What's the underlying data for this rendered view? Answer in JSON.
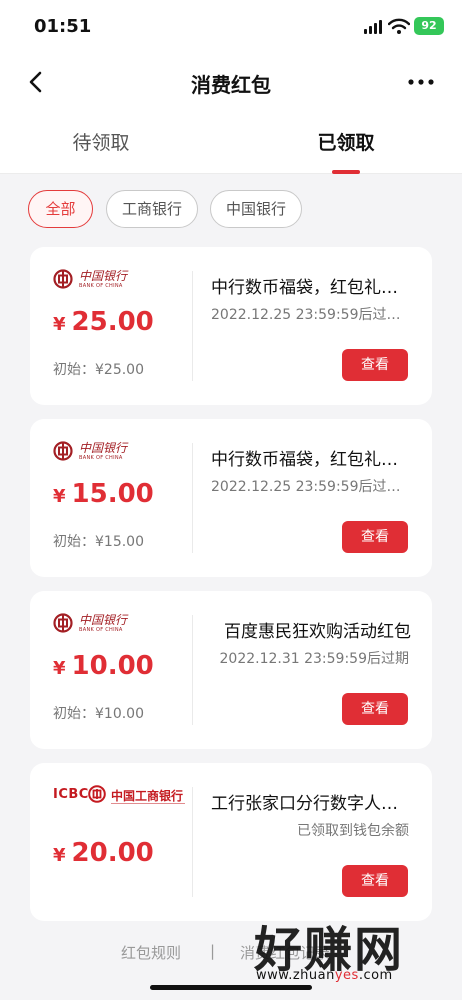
{
  "status_bar": {
    "time": "01:51",
    "battery": "92"
  },
  "nav": {
    "title": "消费红包"
  },
  "tabs": [
    {
      "label": "待领取",
      "active": false
    },
    {
      "label": "已领取",
      "active": true
    }
  ],
  "filters": [
    {
      "label": "全部",
      "active": true
    },
    {
      "label": "工商银行",
      "active": false
    },
    {
      "label": "中国银行",
      "active": false
    }
  ],
  "cards": [
    {
      "bank": "BOC",
      "logo_cn": "中国银行",
      "logo_en": "BANK OF CHINA",
      "currency": "¥",
      "amount": "25.00",
      "initial": "初始：¥25.00",
      "name": "中行数币福袋，红包礼…",
      "subtitle": "2022.12.25 23:59:59后过…",
      "button": "查看"
    },
    {
      "bank": "BOC",
      "logo_cn": "中国银行",
      "logo_en": "BANK OF CHINA",
      "currency": "¥",
      "amount": "15.00",
      "initial": "初始：¥15.00",
      "name": "中行数币福袋，红包礼…",
      "subtitle": "2022.12.25 23:59:59后过…",
      "button": "查看"
    },
    {
      "bank": "BOC",
      "logo_cn": "中国银行",
      "logo_en": "BANK OF CHINA",
      "currency": "¥",
      "amount": "10.00",
      "initial": "初始：¥10.00",
      "name": "百度惠民狂欢购活动红包",
      "subtitle": "2022.12.31 23:59:59后过期",
      "button": "查看"
    },
    {
      "bank": "ICBC",
      "logo_text": "ICBC",
      "logo_cn": "中国工商银行",
      "currency": "¥",
      "amount": "20.00",
      "name": "工行张家口分行数字人…",
      "subtitle": "已领取到钱包余额",
      "button": "查看"
    }
  ],
  "footer": {
    "link1": "红包规则",
    "separator": "|",
    "link2": "消费红包记录"
  },
  "watermark": {
    "cn": "好赚网",
    "url_part1": "www.zhuan",
    "url_highlight": "yes",
    "url_part2": ".com"
  },
  "colors": {
    "accent": "#e02e35",
    "background": "#f4f4f6",
    "battery": "#34c759"
  }
}
